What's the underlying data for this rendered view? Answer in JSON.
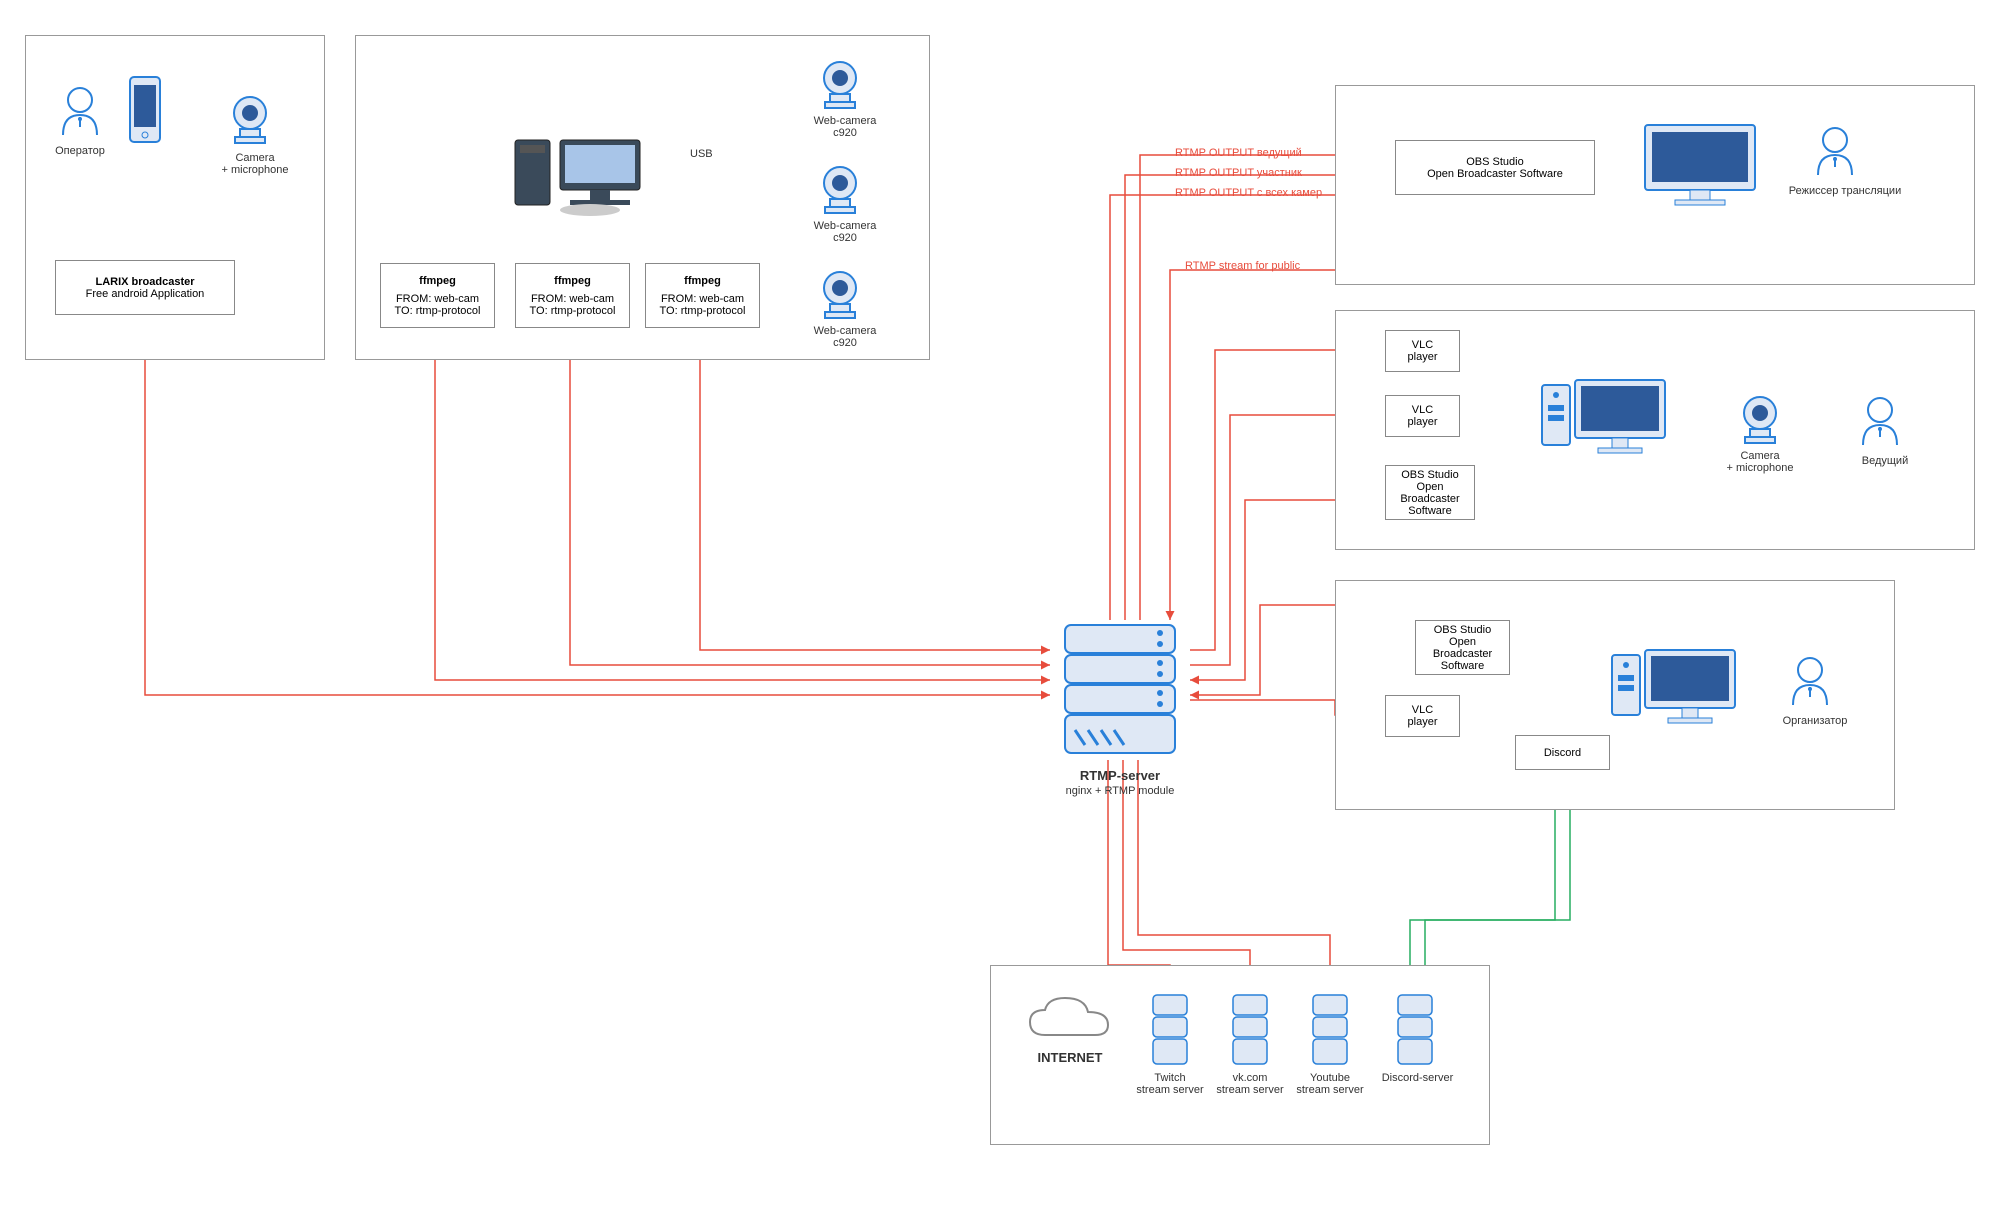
{
  "operator_group": {
    "operator": "Оператор",
    "camera": "Camera\n+ microphone",
    "larix_title": "LARIX broadcaster",
    "larix_sub": "Free android Application"
  },
  "pc_group": {
    "usb": "USB",
    "ffmpeg": "ffmpeg",
    "ffmpeg_from": "FROM: web-cam",
    "ffmpeg_to": "TO: rtmp-protocol",
    "webcam": "Web-camera\nc920"
  },
  "server": {
    "title": "RTMP-server",
    "sub": "nginx + RTMP module"
  },
  "director_group": {
    "obs": "OBS Studio\nOpen Broadcaster Software",
    "role": "Режиссер трансляции",
    "out1": "RTMP OUTPUT ведущий",
    "out2": "RTMP OUTPUT участник",
    "out3": "RTMP OUTPUT с всех камер",
    "stream_public": "RTMP stream for public"
  },
  "host_group": {
    "vlc": "VLC\nplayer",
    "obs": "OBS Studio\nOpen Broadcaster\nSoftware",
    "camera": "Camera\n+ microphone",
    "role": "Ведущий"
  },
  "org_group": {
    "obs": "OBS Studio\nOpen Broadcaster\nSoftware",
    "vlc": "VLC\nplayer",
    "discord": "Discord",
    "role": "Организатор"
  },
  "internet_group": {
    "internet": "INTERNET",
    "twitch": "Twitch\nstream server",
    "vk": "vk.com\nstream server",
    "youtube": "Youtube\nstream server",
    "discord": "Discord-server"
  }
}
